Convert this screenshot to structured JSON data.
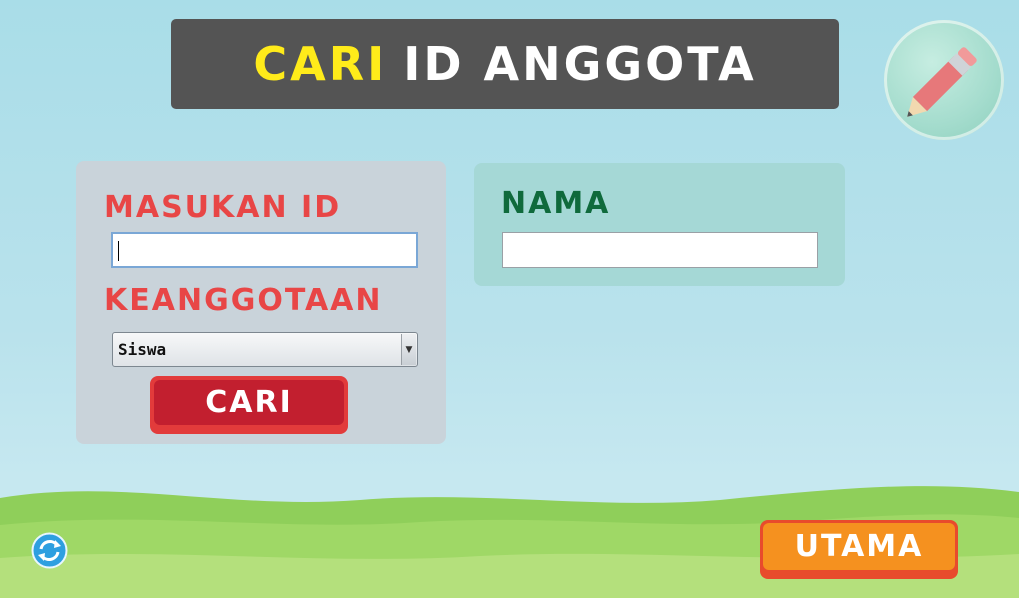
{
  "header": {
    "title_highlight": "CARI",
    "title_rest": "ID ANGGOTA"
  },
  "search_panel": {
    "id_label": "MASUKAN ID",
    "id_value": "",
    "membership_label": "KEANGGOTAAN",
    "membership_selected": "Siswa",
    "search_button": "CARI"
  },
  "result_panel": {
    "name_label": "NAMA",
    "name_value": ""
  },
  "footer": {
    "main_button": "UTAMA"
  },
  "icons": {
    "edit": "pencil-icon",
    "refresh": "refresh-icon"
  },
  "colors": {
    "banner": "#545454",
    "highlight": "#ffeb1a",
    "label_red": "#e84646",
    "label_green": "#0f6a3c",
    "search_btn": "#c21f2f",
    "main_btn": "#f5911f"
  }
}
